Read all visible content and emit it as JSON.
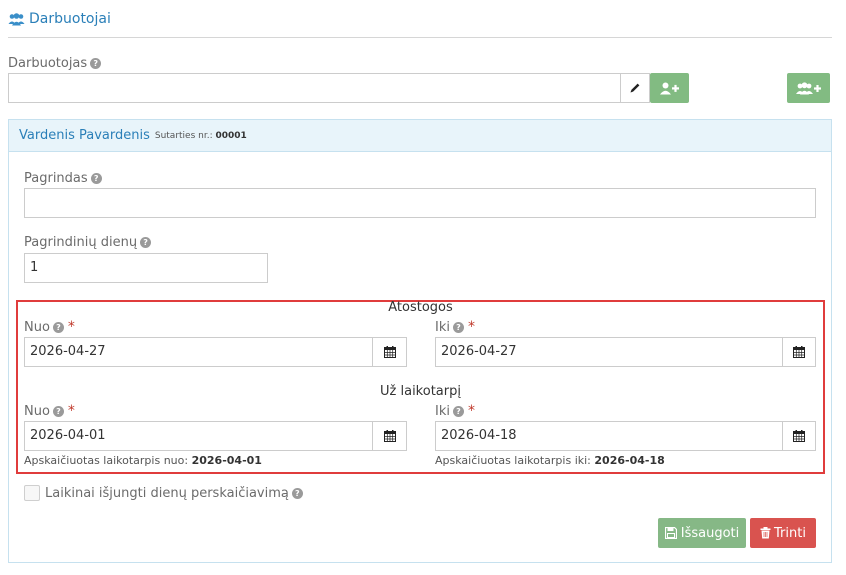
{
  "header": {
    "title": "Darbuotojai",
    "icon": "users-icon"
  },
  "employee": {
    "label": "Darbuotojas",
    "value": "",
    "edit_icon": "pencil-icon",
    "add_icon": "user-plus-icon",
    "add_group_icon": "users-plus-icon"
  },
  "panel": {
    "name": "Vardenis Pavardenis",
    "contract_label": "Sutarties nr.:",
    "contract_number": "00001"
  },
  "basis": {
    "label": "Pagrindas",
    "value": ""
  },
  "base_days": {
    "label": "Pagrindinių dienų",
    "value": "1"
  },
  "vacation": {
    "title": "Atostogos",
    "from_label": "Nuo",
    "from_value": "2026-04-27",
    "to_label": "Iki",
    "to_value": "2026-04-27"
  },
  "period": {
    "title": "Už laikotarpį",
    "from_label": "Nuo",
    "from_value": "2026-04-01",
    "to_label": "Iki",
    "to_value": "2026-04-18",
    "calc_from_label": "Apskaičiuotas laikotarpis nuo:",
    "calc_from_value": "2026-04-01",
    "calc_to_label": "Apskaičiuotas laikotarpis iki:",
    "calc_to_value": "2026-04-18"
  },
  "checkbox": {
    "label": "Laikinai išjungti dienų perskaičiavimą",
    "checked": false
  },
  "buttons": {
    "save": "Išsaugoti",
    "delete": "Trinti"
  },
  "colors": {
    "accent": "#2a7fb8",
    "highlight_border": "#e03c3c",
    "save": "#86b886",
    "delete": "#d9534f",
    "panel_header": "#e8f4fa"
  }
}
